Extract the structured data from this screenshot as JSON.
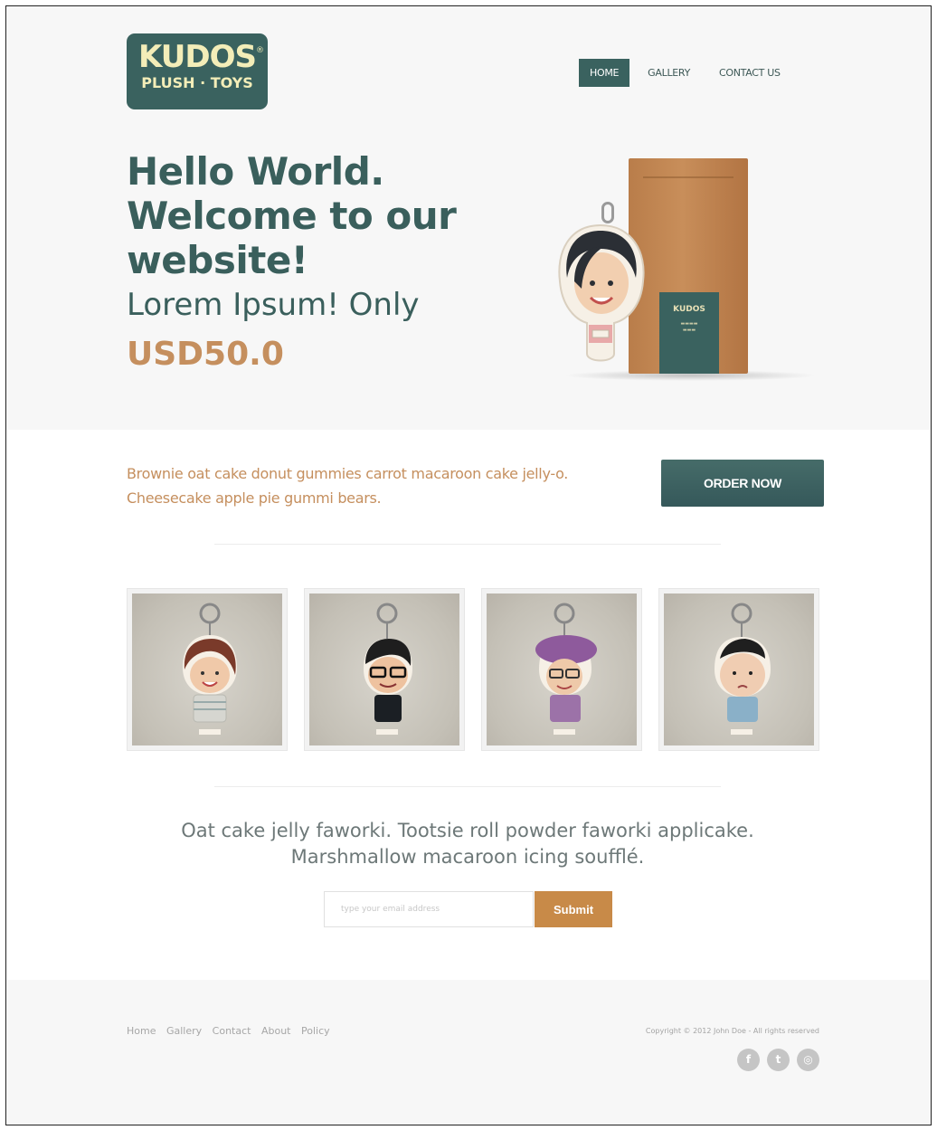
{
  "brand": {
    "logo_line1": "KUDOS",
    "logo_line2": "PLUSH · TOYS",
    "logo_mark": "®",
    "brand_color": "#3a625f",
    "accent_color": "#c58f5e"
  },
  "nav": {
    "items": [
      {
        "label": "HOME",
        "active": true
      },
      {
        "label": "GALLERY",
        "active": false
      },
      {
        "label": "CONTACT US",
        "active": false
      }
    ]
  },
  "hero": {
    "headline_line1": "Hello World.",
    "headline_line2": "Welcome to our",
    "headline_line3": "website!",
    "subtitle": "Lorem Ipsum! Only",
    "price": "USD50.0",
    "bag_label": "KUDOS"
  },
  "promo": {
    "text_line1": "Brownie oat cake donut gummies carrot macaroon cake jelly-o.",
    "text_line2": "Cheesecake apple pie gummi bears.",
    "order_button": "ORDER NOW"
  },
  "gallery": {
    "items": [
      {
        "name": "toy-woman-short-hair"
      },
      {
        "name": "toy-man-glasses"
      },
      {
        "name": "toy-woman-beret"
      },
      {
        "name": "toy-baby"
      }
    ]
  },
  "newsletter": {
    "tagline_line1": "Oat cake jelly faworki. Tootsie roll powder faworki applicake.",
    "tagline_line2": "Marshmallow macaroon icing soufflé.",
    "email_placeholder": "type your email address",
    "submit_label": "Submit"
  },
  "footer": {
    "links": [
      "Home",
      "Gallery",
      "Contact",
      "About",
      "Policy"
    ],
    "copyright": "Copyright © 2012 John Doe - All rights reserved",
    "social": [
      {
        "icon": "facebook-icon",
        "glyph": "f"
      },
      {
        "icon": "twitter-icon",
        "glyph": "t"
      },
      {
        "icon": "dribbble-icon",
        "glyph": "◎"
      }
    ]
  }
}
